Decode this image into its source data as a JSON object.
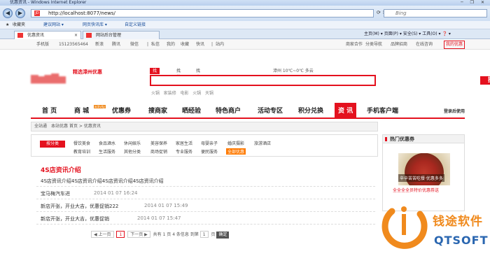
{
  "browser": {
    "window_title": "优惠资讯 - Windows Internet Explorer",
    "url": "http://localhost:8077/news/",
    "search_placeholder": "Bing",
    "favorites_label": "收藏夹",
    "fav_items": [
      "建议网站 ▾",
      "网页快讯库 ▾",
      "自定义链接"
    ],
    "tabs": [
      {
        "label": "优惠资讯"
      },
      {
        "label": "网站后台管理"
      }
    ],
    "command_items": [
      "主页(M) ▾",
      "页面(P) ▾",
      "安全(S) ▾",
      "工具(O) ▾",
      "❓ ▾"
    ]
  },
  "topbar": {
    "left": [
      "手机版",
      "15123565464",
      "新浪",
      "腾讯",
      "微信",
      "|",
      "私信",
      "我的",
      "收藏",
      "快讯",
      "|",
      "站内"
    ],
    "right": [
      "商家合作",
      "分类导航",
      "品牌招商",
      "在线咨询",
      "我的优惠"
    ]
  },
  "header": {
    "logo_tagline": "精选漳州优惠",
    "search_tabs": [
      "找优惠",
      "找优惠",
      "找商家"
    ],
    "search_button": "搜 索",
    "hot_words": [
      "火锅",
      "家装修",
      "电影",
      "火锅",
      "天锅"
    ],
    "weather": "漳州   10℃~0℃  多云"
  },
  "nav": {
    "items": [
      "首 页",
      "商 城",
      "优惠券",
      "搜商家",
      "晒经验",
      "特色商户",
      "活动专区",
      "积分兑换",
      "资 讯",
      "手机客户端"
    ],
    "active": "资 讯",
    "mall_badge": "activity",
    "login": "登录后使用"
  },
  "breadcrumb": [
    "全站通",
    "本站优惠",
    "首页 > 优惠资讯"
  ],
  "categories": {
    "label": "按分类",
    "row1": [
      "餐饮美食",
      "食品酒水",
      "休闲娱乐",
      "美容保养",
      "家居生活",
      "母婴亲子",
      "婚庆摄影",
      "旅游酒店"
    ],
    "row2": [
      "教育培训",
      "生活服务",
      "其他分类",
      "商场促销",
      "专业服务",
      "便民服务",
      "全部优惠"
    ]
  },
  "article": {
    "title": "4S店资讯介绍",
    "body": "4S店资讯介绍4S店资讯介绍4S店资讯介绍4S店资讯介绍",
    "rows": [
      {
        "title": "宝马梅汽车进",
        "date": "2014 01 07 16:24"
      },
      {
        "title": "新店开张，开业大吉，优惠促销222",
        "date": "2014 01 07 15:49"
      },
      {
        "title": "新店开张，开业大吉，优惠促销",
        "date": "2014 01 07 15:47"
      }
    ]
  },
  "pager": {
    "prev": "◀ 上一页",
    "current": "1",
    "next": "下一页 ▶",
    "summary": "共有 1 页 4 条信息  到第",
    "page_input": "1",
    "page_unit": "页",
    "go": "确定"
  },
  "sidebar": {
    "heading": "热门优惠券",
    "image_text": "辛辛苦苦吃餐·优惠多多",
    "caption": "全全全全员特价优惠券送"
  },
  "watermark": {
    "cn": "钱途软件",
    "en": "QTSOFT"
  }
}
